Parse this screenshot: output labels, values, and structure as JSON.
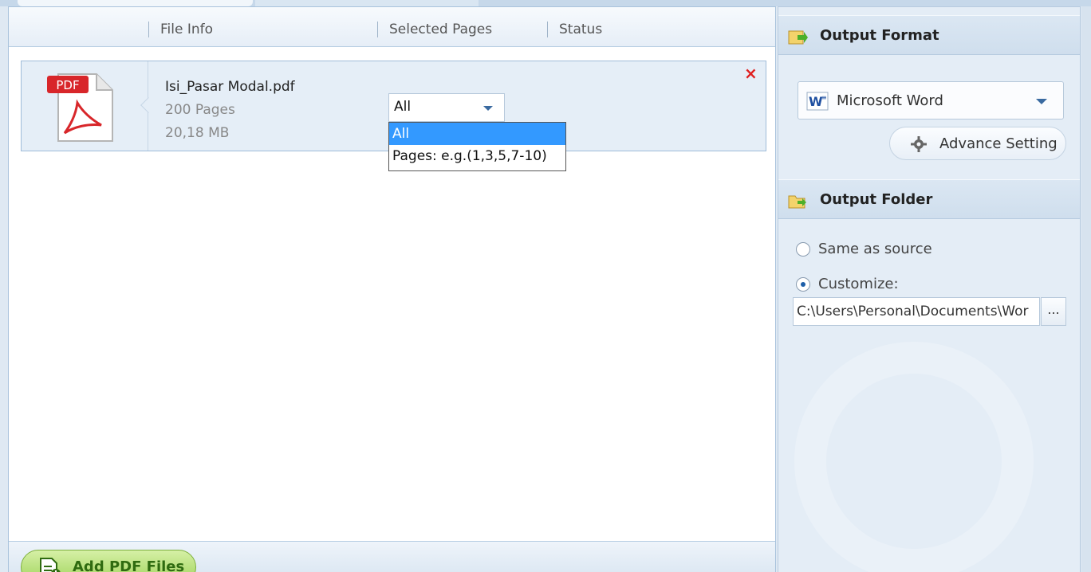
{
  "columns": {
    "file_info": "File Info",
    "selected_pages": "Selected Pages",
    "status": "Status"
  },
  "file": {
    "icon_label": "PDF",
    "name": "Isi_Pasar Modal.pdf",
    "pages": "200 Pages",
    "size": "20,18  MB",
    "close": "×"
  },
  "page_select": {
    "value": "All",
    "options": [
      "All",
      "Pages: e.g.(1,3,5,7-10)"
    ],
    "highlighted": "All"
  },
  "add_button": "Add PDF Files",
  "output_format": {
    "title": "Output Format",
    "selected": "Microsoft Word",
    "advance_setting": "Advance Setting"
  },
  "output_folder": {
    "title": "Output Folder",
    "same_as_source": "Same as source",
    "customize": "Customize:",
    "selected_option": "Customize:",
    "path": "C:\\Users\\Personal\\Documents\\Wor",
    "browse": "..."
  },
  "colors": {
    "accent_blue": "#3399ff",
    "close_red": "#e02020",
    "add_green": "#9fd35a"
  }
}
